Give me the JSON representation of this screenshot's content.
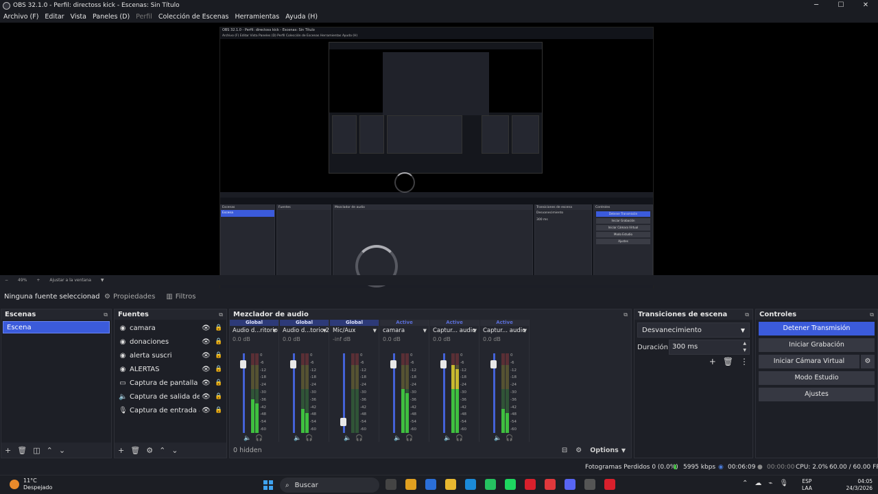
{
  "window": {
    "title": "OBS 32.1.0 - Perfil: directoss kick - Escenas: Sin Título",
    "minimize": "─",
    "maximize": "☐",
    "close": "✕"
  },
  "menu": [
    "Archivo (F)",
    "Editar",
    "Vista",
    "Paneles (D)",
    "Perfil",
    "Colección de Escenas",
    "Herramientas",
    "Ayuda (H)"
  ],
  "zoom": {
    "minus": "−",
    "value": "49%",
    "plus": "+",
    "fit": "Ajustar a la ventana",
    "dropdown": "▼"
  },
  "context": {
    "no_source": "Ninguna fuente seleccionada",
    "properties": "Propiedades",
    "filters": "Filtros"
  },
  "scenes": {
    "title": "Escenas",
    "items": [
      "Escena"
    ]
  },
  "sources": {
    "title": "Fuentes",
    "items": [
      {
        "name": "camara",
        "icon": "camera-icon"
      },
      {
        "name": "donaciones",
        "icon": "browser-icon"
      },
      {
        "name": "alerta suscri",
        "icon": "browser-icon"
      },
      {
        "name": "ALERTAS",
        "icon": "browser-icon"
      },
      {
        "name": "Captura de pantalla",
        "icon": "monitor-icon"
      },
      {
        "name": "Captura de salida de audio",
        "icon": "speaker-icon"
      },
      {
        "name": "Captura de entrada audio",
        "icon": "mic-icon"
      }
    ]
  },
  "mixer": {
    "title": "Mezclador de audio",
    "hidden_label": "0 hidden",
    "options_label": "Options",
    "channels": [
      {
        "tag": "Global",
        "tag_type": "global",
        "name": "Audio d...ritorio",
        "db": "0.0 dB",
        "level": 0.42,
        "fader": 0.9
      },
      {
        "tag": "Global",
        "tag_type": "global",
        "name": "Audio d...torio 2",
        "db": "0.0 dB",
        "level": 0.3,
        "fader": 0.9
      },
      {
        "tag": "Global",
        "tag_type": "global",
        "name": "Mic/Aux",
        "db": "-inf dB",
        "level": 0.0,
        "fader": 0.1
      },
      {
        "tag": "Active",
        "tag_type": "active",
        "name": "camara",
        "db": "0.0 dB",
        "level": 0.55,
        "fader": 0.9
      },
      {
        "tag": "Active",
        "tag_type": "active",
        "name": "Captur... audio",
        "db": "0.0 dB",
        "level": 0.85,
        "fader": 0.9
      },
      {
        "tag": "Active",
        "tag_type": "active",
        "name": "Captur... audio",
        "db": "0.0 dB",
        "level": 0.3,
        "fader": 0.9
      }
    ],
    "scale": [
      "0",
      "-6",
      "-12",
      "-18",
      "-24",
      "-30",
      "-36",
      "-42",
      "-48",
      "-54",
      "-60"
    ]
  },
  "transitions": {
    "title": "Transiciones de escena",
    "selected": "Desvanecimiento",
    "duration_label": "Duración",
    "duration_value": "300 ms"
  },
  "controls": {
    "title": "Controles",
    "stop_stream": "Detener Transmisión",
    "start_rec": "Iniciar Grabación",
    "virtual_cam": "Iniciar Cámara Virtual",
    "studio": "Modo Estudio",
    "settings": "Ajustes"
  },
  "status": {
    "dropped": "Fotogramas Perdidos 0 (0.0%)",
    "bitrate": "5995 kbps",
    "stream_time": "00:06:09",
    "rec_time": "00:00:00",
    "cpu": "CPU: 2.0%",
    "fps": "60.00 / 60.00 FPS"
  },
  "taskbar": {
    "temp": "11°C",
    "weather": "Despejado",
    "search": "Buscar",
    "lang1": "ESP",
    "lang2": "LAA",
    "time": "04:05",
    "date": "24/3/2026"
  },
  "nested": {
    "title": "OBS 32.1.0 - Perfil: directoss kick - Escenas: Sin Título",
    "menu": "Archivo (F)   Editar   Vista   Paneles (D)   Perfil   Colección de Escenas   Herramientas   Ayuda (H)",
    "no_source": "Ninguna fuente seleccionada",
    "scenes": "Escenas",
    "scene": "Escena",
    "sources": "Fuentes",
    "mixer": "Mezclador de audio",
    "transitions": "Transiciones de escena",
    "controls": "Controles",
    "stop": "Detener Transmisión",
    "rec": "Iniciar Grabación",
    "vcam": "Iniciar Cámara Virtual",
    "studio": "Modo Estudio",
    "settings": "Ajustes",
    "fade": "Desvanecimiento",
    "dur": "300 ms"
  },
  "colors": {
    "accent": "#3b5bdb",
    "meter_green": "#3fbf3f",
    "meter_yellow": "#c7b82f",
    "meter_red": "#d83a3a",
    "panel": "#24262e",
    "bg": "#1d1f26"
  }
}
